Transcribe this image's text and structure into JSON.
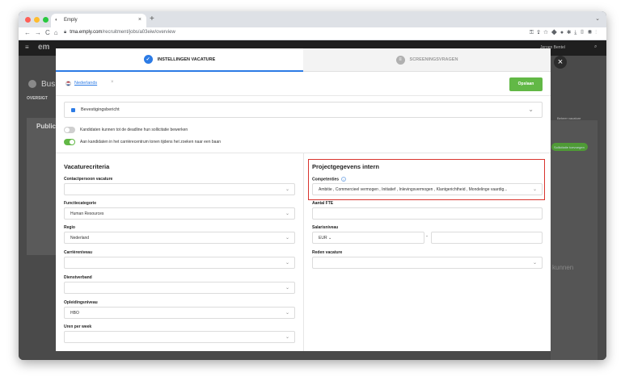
{
  "browser": {
    "tab_title": "Emply",
    "url_host": "tma.emply.com",
    "url_path": "/recruitment/jobs/a03eiw/overview",
    "new_tab_label": "+",
    "tab_close": "×"
  },
  "background_app": {
    "logo": "em",
    "page_title": "Bus",
    "tab_overview": "OVERSIGT",
    "card_label": "Publica",
    "user_name": "Jeroen Bentel",
    "right_pill": "Sollicitatie toevoegen",
    "right_text": "kunnen",
    "right_link": "Beheer vacature"
  },
  "modal": {
    "close_label": "×",
    "steps": [
      {
        "label": "INSTELLINGEN VACATURE",
        "active": true
      },
      {
        "label": "SCREENINGSVRAGEN",
        "active": false
      }
    ],
    "language": "Nederlands",
    "language_remove": "×",
    "save_label": "Opslaan",
    "confirmation_message": "Bevestigingsbericht",
    "toggles": [
      {
        "label": "Kandidaten kunnen tot de deadline hun sollicitatie bewerken",
        "on": false
      },
      {
        "label": "Aan kandidaten in het carrièrecentrum tonen tijdens het zoeken naar een baan",
        "on": true
      }
    ],
    "left_section": {
      "title": "Vacaturecriteria",
      "fields": [
        {
          "label": "Contactpersoon vacature",
          "value": ""
        },
        {
          "label": "Functiecategorie",
          "value": "Human Resources"
        },
        {
          "label": "Regio",
          "value": "Nederland"
        },
        {
          "label": "Carrièreniveau",
          "value": ""
        },
        {
          "label": "Dienstverband",
          "value": ""
        },
        {
          "label": "Opleidingsniveau",
          "value": "HBO"
        },
        {
          "label": "Uren per week",
          "value": ""
        }
      ]
    },
    "right_section": {
      "title": "Projectgegevens intern",
      "competencies_label": "Competenties",
      "competencies_value": "Ambitie , Commercieel vermogen , Initiatief , Inlevingsvermogen , Klantgerichtheid , Mondelinge vaardig...",
      "fte_label": "Aantal FTE",
      "fte_value": "",
      "salary_label": "Salarisniveau",
      "salary_currency": "EUR",
      "salary_separator": "-",
      "reason_label": "Reden vacature",
      "reason_value": ""
    }
  },
  "colors": {
    "accent_blue": "#2c7be5",
    "save_green": "#62b846",
    "highlight_red": "#d9352f"
  }
}
